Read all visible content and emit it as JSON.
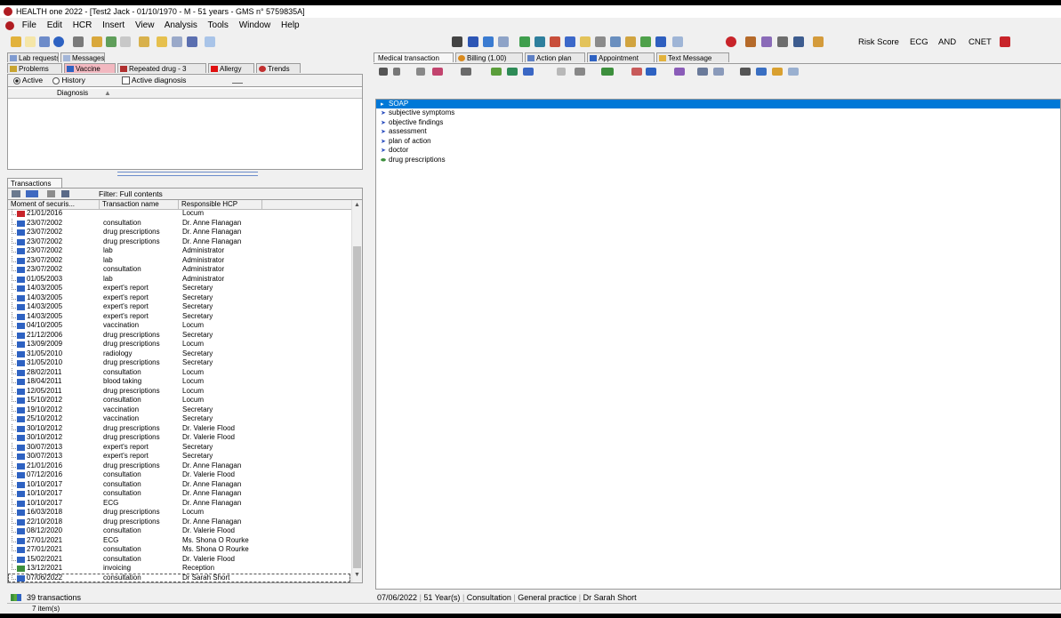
{
  "window": {
    "title": "HEALTH one 2022 - [Test2 Jack - 01/10/1970 - M - 51 years - GMS n° 5759835A]"
  },
  "menu": [
    "File",
    "Edit",
    "HCR",
    "Insert",
    "View",
    "Analysis",
    "Tools",
    "Window",
    "Help"
  ],
  "toolbar_right": {
    "risk_score": "Risk Score",
    "ecg": "ECG",
    "and": "AND",
    "cnet": "CNET"
  },
  "left": {
    "top_tabs": [
      "Lab requests",
      "Messages"
    ],
    "tabs": [
      "Problems",
      "Vaccine",
      "Repeated drug - 3",
      "Allergy",
      "Trends"
    ],
    "filter": {
      "active_label": "Active",
      "history_label": "History",
      "active_diagnosis_label": "Active diagnosis"
    },
    "diagnosis_header": "Diagnosis",
    "transactions_tab": "Transactions",
    "filter_text": "Filter: Full contents",
    "columns": [
      "Moment of securis...",
      "Transaction name",
      "Responsible HCP"
    ],
    "rows": [
      {
        "date": "21/01/2016",
        "name": "",
        "hcp": "Locum",
        "icon": "red"
      },
      {
        "date": "23/07/2002",
        "name": "consultation",
        "hcp": "Dr. Anne Flanagan",
        "icon": "blue"
      },
      {
        "date": "23/07/2002",
        "name": "drug prescriptions",
        "hcp": "Dr. Anne Flanagan",
        "icon": "blue"
      },
      {
        "date": "23/07/2002",
        "name": "drug prescriptions",
        "hcp": "Dr. Anne Flanagan",
        "icon": "blue"
      },
      {
        "date": "23/07/2002",
        "name": "lab",
        "hcp": "Administrator",
        "icon": "blue"
      },
      {
        "date": "23/07/2002",
        "name": "lab",
        "hcp": "Administrator",
        "icon": "blue"
      },
      {
        "date": "23/07/2002",
        "name": "consultation",
        "hcp": "Administrator",
        "icon": "blue"
      },
      {
        "date": "01/05/2003",
        "name": "lab",
        "hcp": "Administrator",
        "icon": "blue"
      },
      {
        "date": "14/03/2005",
        "name": "expert's report",
        "hcp": "Secretary",
        "icon": "blue"
      },
      {
        "date": "14/03/2005",
        "name": "expert's report",
        "hcp": "Secretary",
        "icon": "blue"
      },
      {
        "date": "14/03/2005",
        "name": "expert's report",
        "hcp": "Secretary",
        "icon": "blue"
      },
      {
        "date": "14/03/2005",
        "name": "expert's report",
        "hcp": "Secretary",
        "icon": "blue"
      },
      {
        "date": "04/10/2005",
        "name": "vaccination",
        "hcp": "Locum",
        "icon": "blue"
      },
      {
        "date": "21/12/2006",
        "name": "drug prescriptions",
        "hcp": "Secretary",
        "icon": "blue"
      },
      {
        "date": "13/09/2009",
        "name": "drug prescriptions",
        "hcp": "Locum",
        "icon": "blue"
      },
      {
        "date": "31/05/2010",
        "name": "radiology",
        "hcp": "Secretary",
        "icon": "blue"
      },
      {
        "date": "31/05/2010",
        "name": "drug prescriptions",
        "hcp": "Secretary",
        "icon": "blue"
      },
      {
        "date": "28/02/2011",
        "name": "consultation",
        "hcp": "Locum",
        "icon": "blue"
      },
      {
        "date": "18/04/2011",
        "name": "blood taking",
        "hcp": "Locum",
        "icon": "blue"
      },
      {
        "date": "12/05/2011",
        "name": "drug prescriptions",
        "hcp": "Locum",
        "icon": "blue"
      },
      {
        "date": "15/10/2012",
        "name": "consultation",
        "hcp": "Locum",
        "icon": "blue"
      },
      {
        "date": "19/10/2012",
        "name": "vaccination",
        "hcp": "Secretary",
        "icon": "blue"
      },
      {
        "date": "25/10/2012",
        "name": "vaccination",
        "hcp": "Secretary",
        "icon": "blue"
      },
      {
        "date": "30/10/2012",
        "name": "drug prescriptions",
        "hcp": "Dr. Valerie Flood",
        "icon": "blue"
      },
      {
        "date": "30/10/2012",
        "name": "drug prescriptions",
        "hcp": "Dr. Valerie Flood",
        "icon": "blue"
      },
      {
        "date": "30/07/2013",
        "name": "expert's report",
        "hcp": "Secretary",
        "icon": "blue"
      },
      {
        "date": "30/07/2013",
        "name": "expert's report",
        "hcp": "Secretary",
        "icon": "blue"
      },
      {
        "date": "21/01/2016",
        "name": "drug prescriptions",
        "hcp": "Dr. Anne Flanagan",
        "icon": "blue"
      },
      {
        "date": "07/12/2016",
        "name": "consultation",
        "hcp": "Dr. Valerie Flood",
        "icon": "blue"
      },
      {
        "date": "10/10/2017",
        "name": "consultation",
        "hcp": "Dr. Anne Flanagan",
        "icon": "blue"
      },
      {
        "date": "10/10/2017",
        "name": "consultation",
        "hcp": "Dr. Anne Flanagan",
        "icon": "blue"
      },
      {
        "date": "10/10/2017",
        "name": "ECG",
        "hcp": "Dr. Anne Flanagan",
        "icon": "blue"
      },
      {
        "date": "16/03/2018",
        "name": "drug prescriptions",
        "hcp": "Locum",
        "icon": "blue"
      },
      {
        "date": "22/10/2018",
        "name": "drug prescriptions",
        "hcp": "Dr. Anne Flanagan",
        "icon": "blue"
      },
      {
        "date": "08/12/2020",
        "name": "consultation",
        "hcp": "Dr. Valerie Flood",
        "icon": "blue"
      },
      {
        "date": "27/01/2021",
        "name": "ECG",
        "hcp": "Ms. Shona O Rourke",
        "icon": "blue"
      },
      {
        "date": "27/01/2021",
        "name": "consultation",
        "hcp": "Ms. Shona O Rourke",
        "icon": "blue"
      },
      {
        "date": "15/02/2021",
        "name": "consultation",
        "hcp": "Dr. Valerie Flood",
        "icon": "blue"
      },
      {
        "date": "13/12/2021",
        "name": "invoicing",
        "hcp": "Reception",
        "icon": "green"
      },
      {
        "date": "07/06/2022",
        "name": "consultation",
        "hcp": "Dr Sarah Short",
        "icon": "blue"
      }
    ],
    "count_label": "39 transactions",
    "items_label": "7 item(s)"
  },
  "right": {
    "tabs": [
      "Medical transaction",
      "Billing (1.00)",
      "Action plan",
      "Appointment",
      "Text Message"
    ],
    "soap_items": [
      "SOAP",
      "subjective symptoms",
      "objective findings",
      "assessment",
      "plan of action",
      "doctor",
      "drug prescriptions"
    ],
    "status": {
      "date": "07/06/2022",
      "age": "51 Year(s)",
      "type": "Consultation",
      "specialty": "General practice",
      "doctor": "Dr Sarah Short"
    }
  },
  "colors": {
    "selection": "#0078d7",
    "brand": "#b01c22",
    "vaccine_tab": "#f2b8c0"
  }
}
